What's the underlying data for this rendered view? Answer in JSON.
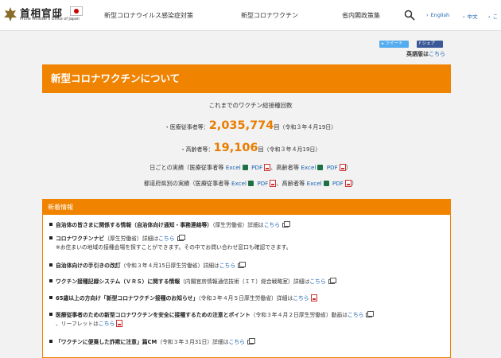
{
  "header": {
    "logo_jp": "首相官邸",
    "logo_en": "Prime Minister's Office of Japan",
    "nav": [
      "新型コロナウイルス感染症対策",
      "新型コロナワクチン",
      "省内閣政策集"
    ],
    "langs": [
      "English",
      "中文"
    ],
    "partial": "こ"
  },
  "share": {
    "tweet": "ツイート",
    "fb": "シェア"
  },
  "english_link": {
    "label": "英語版は",
    "link": "こちら"
  },
  "title": "新型コロナワクチンについて",
  "total_label": "これまでのワクチン総接種回数",
  "stats": [
    {
      "label": "・医療従事者等：",
      "value": "2,035,774",
      "unit": "回",
      "date": "（令和３年４月19日）"
    },
    {
      "label": "・高齢者等：",
      "value": "19,106",
      "unit": "回",
      "date": "（令和３年４月19日）"
    }
  ],
  "daily": {
    "prefix": "日ごとの実績（医療従事者等",
    "mid": "、高齢者等",
    "excel": "Excel",
    "pdf": "PDF",
    "close": "）"
  },
  "pref": {
    "prefix": "都道府県別の実績（医療従事者等",
    "mid": "、高齢者等",
    "excel": "Excel",
    "pdf": "PDF",
    "close": "）"
  },
  "news": {
    "header": "新着情報",
    "items": [
      {
        "bold": "自治体の皆さまに関係する情報（自治体向け通知・事務連絡等）",
        "rest": "（厚生労働省）詳細は",
        "link": "こちら"
      },
      {
        "bold": "コロナワクチンナビ",
        "rest": "（厚生労働省）詳細は",
        "link": "こちら",
        "sub": "※お住まいの地域の接種会場を探すことができます。その中でお問い合わせ窓口も確認できます。"
      },
      {
        "bold": "自治体向けの手引きの改訂",
        "rest": "（令和３年４月15日厚生労働省）詳細は",
        "link": "こちら"
      },
      {
        "bold": "ワクチン接種記録システム（ＶＲＳ）に関する情報",
        "rest": "（内閣官房情報通信技術（ＩＴ）総合戦略室）詳細は",
        "link": "こちら"
      },
      {
        "bold": "65歳以上の方向け「新型コロナワクチン接種のお知らせ」",
        "rest": "（令和３年４月５日厚生労働省）詳細は",
        "link": "こちら"
      },
      {
        "bold": "医療従事者のための新型コロナワクチンを安全に接種するための注意とポイント",
        "rest": "（令和３年４月２日厚生労働省）動画は",
        "link": "こちら",
        "sub_prefix": "、リーフレットは",
        "sub_link": "こちら"
      },
      {
        "bold": "「ワクチンに便乗した詐欺に注意」篇CM",
        "rest": "（令和３年３月31日）詳細は",
        "link": "こちら"
      }
    ]
  }
}
